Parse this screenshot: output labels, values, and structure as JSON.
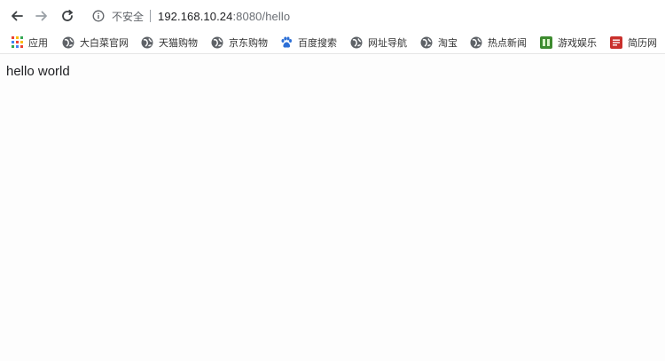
{
  "toolbar": {
    "back_label": "",
    "forward_label": "",
    "reload_label": "",
    "security_text": "不安全",
    "url_host": "192.168.10.24",
    "url_rest": ":8080/hello"
  },
  "bookmarks": [
    {
      "label": "应用",
      "icon": "apps-grid-icon"
    },
    {
      "label": "大白菜官网",
      "icon": "globe-icon"
    },
    {
      "label": "天猫购物",
      "icon": "globe-icon"
    },
    {
      "label": "京东购物",
      "icon": "globe-icon"
    },
    {
      "label": "百度搜索",
      "icon": "baidu-paw-icon"
    },
    {
      "label": "网址导航",
      "icon": "globe-icon"
    },
    {
      "label": "淘宝",
      "icon": "globe-icon"
    },
    {
      "label": "热点新闻",
      "icon": "globe-icon"
    },
    {
      "label": "游戏娱乐",
      "icon": "game-icon"
    },
    {
      "label": "简历网",
      "icon": "resume-icon"
    }
  ],
  "page": {
    "text": "hello world"
  },
  "colors": {
    "accent": "#2c6fd6",
    "globe": "#5f6368",
    "game": "#3d8b2f",
    "resume": "#c9302c"
  }
}
